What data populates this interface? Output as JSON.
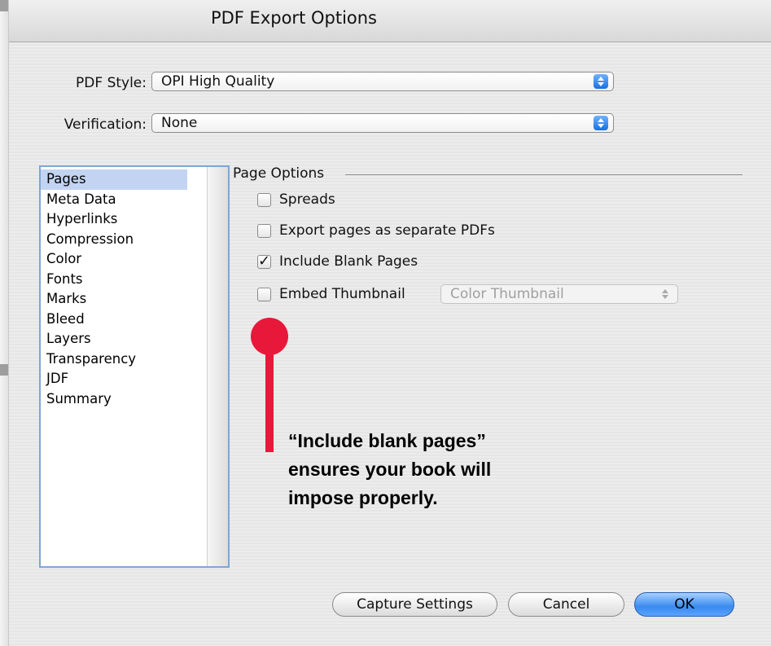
{
  "window": {
    "title": "PDF Export Options"
  },
  "pdf_style": {
    "label": "PDF Style:",
    "value": "OPI High Quality"
  },
  "verification": {
    "label": "Verification:",
    "value": "None"
  },
  "sidebar": {
    "items": [
      {
        "label": "Pages",
        "selected": true
      },
      {
        "label": "Meta Data"
      },
      {
        "label": "Hyperlinks"
      },
      {
        "label": "Compression"
      },
      {
        "label": "Color"
      },
      {
        "label": "Fonts"
      },
      {
        "label": "Marks"
      },
      {
        "label": "Bleed"
      },
      {
        "label": "Layers"
      },
      {
        "label": "Transparency"
      },
      {
        "label": "JDF"
      },
      {
        "label": "Summary"
      }
    ]
  },
  "page_options": {
    "title": "Page Options",
    "spreads": {
      "label": "Spreads",
      "checked": false
    },
    "separate": {
      "label": "Export pages as separate PDFs",
      "checked": false
    },
    "blank": {
      "label": "Include Blank Pages",
      "checked": true,
      "mark": "✓"
    },
    "thumbnail": {
      "label": "Embed Thumbnail",
      "checked": false,
      "select_value": "Color Thumbnail"
    }
  },
  "annotation": {
    "line1": "“Include blank pages”",
    "line2": "ensures your book will",
    "line3": "impose properly.",
    "marker_color": "#e8183a"
  },
  "buttons": {
    "capture": "Capture Settings",
    "cancel": "Cancel",
    "ok": "OK"
  }
}
